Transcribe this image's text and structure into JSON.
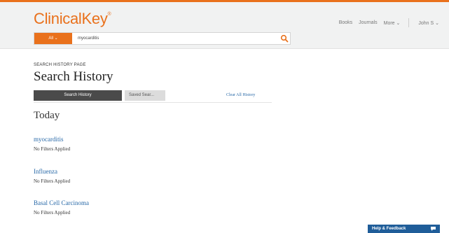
{
  "header": {
    "logo": "ClinicalKey",
    "logo_mark": "®",
    "nav": {
      "books": "Books",
      "journals": "Journals",
      "more": "More ⌄",
      "user": "John S ⌄"
    }
  },
  "search": {
    "scope_label": "All ⌄",
    "query": "myocarditis"
  },
  "page": {
    "label": "SEARCH HISTORY PAGE",
    "title": "Search History",
    "tabs": {
      "search_history": "Search History",
      "saved_searches": "Saved Sear..."
    },
    "clear_all": "Clear All History",
    "section": "Today"
  },
  "history": [
    {
      "term": "myocarditis",
      "filters": "No Filters Applied"
    },
    {
      "term": "Influenza",
      "filters": "No Filters Applied"
    },
    {
      "term": "Basal Cell Carcinoma",
      "filters": "No Filters Applied"
    }
  ],
  "help": {
    "label": "Help & Feedback"
  },
  "colors": {
    "brand": "#e9711c",
    "link": "#2a6aa8",
    "help": "#1f5d99",
    "tab_active": "#4a4a4a"
  }
}
